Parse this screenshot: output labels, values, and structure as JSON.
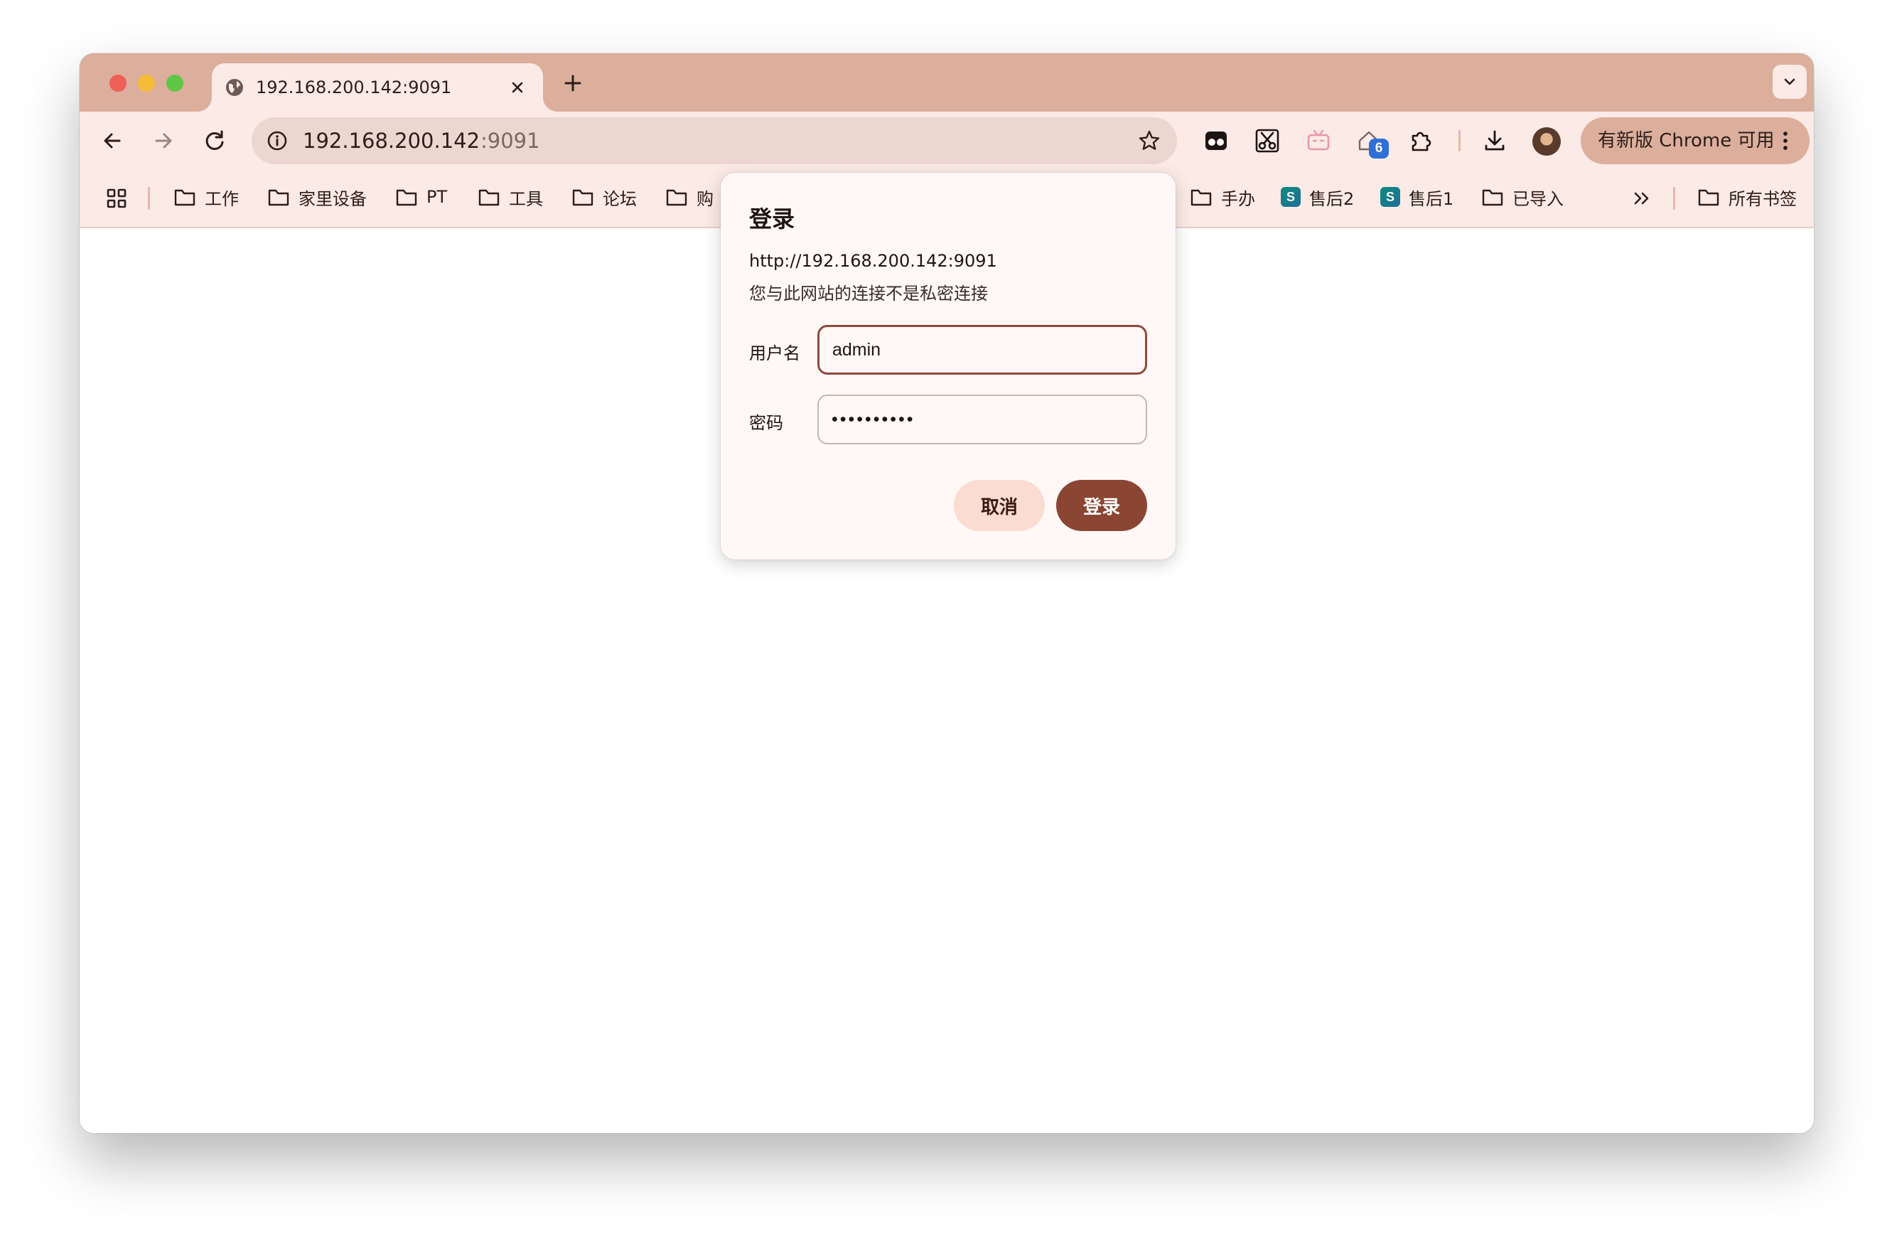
{
  "tab": {
    "title": "192.168.200.142:9091"
  },
  "omnibox": {
    "host": "192.168.200.142",
    "port": ":9091"
  },
  "extensions": {
    "badge_count": "6"
  },
  "update_chip": {
    "label": "有新版 Chrome 可用"
  },
  "bookmarks": {
    "items": [
      {
        "label": "工作",
        "type": "folder"
      },
      {
        "label": "家里设备",
        "type": "folder"
      },
      {
        "label": "PT",
        "type": "folder"
      },
      {
        "label": "工具",
        "type": "folder"
      },
      {
        "label": "论坛",
        "type": "folder"
      },
      {
        "label": "购",
        "type": "folder"
      },
      {
        "label": "手办",
        "type": "folder"
      },
      {
        "label": "售后2",
        "type": "site",
        "icon_letter": "S"
      },
      {
        "label": "售后1",
        "type": "site",
        "icon_letter": "S"
      },
      {
        "label": "已导入",
        "type": "folder"
      }
    ],
    "all_bookmarks": "所有书签"
  },
  "dialog": {
    "title": "登录",
    "url": "http://192.168.200.142:9091",
    "warning": "您与此网站的连接不是私密连接",
    "username_label": "用户名",
    "username_value": "admin",
    "password_label": "密码",
    "password_value": "••••••••••",
    "cancel_label": "取消",
    "submit_label": "登录"
  },
  "colors": {
    "tab_strip": "#dcae9c",
    "toolbar": "#fbeae6",
    "accent": "#8a4533",
    "cancel_button": "#fadcd3"
  }
}
